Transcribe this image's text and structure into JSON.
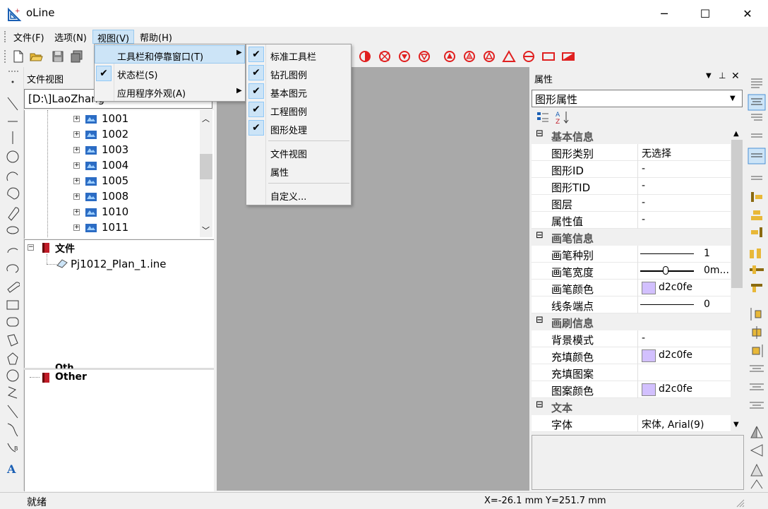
{
  "window": {
    "title": "oLine",
    "minimize": "─",
    "maximize": "☐",
    "close": "✕"
  },
  "menubar": [
    "文件(F)",
    "选项(N)",
    "视图(V)",
    "帮助(H)"
  ],
  "file_view": {
    "title": "文件视图",
    "path": "[D:\\]LaoZhang",
    "nodes": [
      "1001",
      "1002",
      "1003",
      "1004",
      "1005",
      "1008",
      "1010",
      "1011"
    ],
    "section_file": "文件",
    "file_item": "Pj1012_Plan_1.ine",
    "section_other": "Other",
    "other_partial": "Oth"
  },
  "view_menu": {
    "items": [
      "工具栏和停靠窗口(T)",
      "状态栏(S)",
      "应用程序外观(A)"
    ],
    "checked": [
      false,
      true,
      false
    ]
  },
  "toolbar_submenu": {
    "checked_items": [
      "标准工具栏",
      "钻孔图例",
      "基本图元",
      "工程图例",
      "图形处理"
    ],
    "items": [
      "文件视图",
      "属性",
      "自定义..."
    ]
  },
  "properties": {
    "title": "属性",
    "selector": "图形属性",
    "categories": {
      "basic": "基本信息",
      "pen": "画笔信息",
      "brush": "画刷信息",
      "text": "文本"
    },
    "basic_rows": [
      {
        "name": "图形类别",
        "value": "无选择"
      },
      {
        "name": "图形ID",
        "value": "-"
      },
      {
        "name": "图形TID",
        "value": "-"
      },
      {
        "name": "图层",
        "value": "-"
      },
      {
        "name": "属性值",
        "value": "-"
      }
    ],
    "pen_rows": [
      {
        "name": "画笔种别",
        "value": "1"
      },
      {
        "name": "画笔宽度",
        "value": "0m..."
      },
      {
        "name": "画笔颜色",
        "value": "d2c0fe"
      },
      {
        "name": "线条端点",
        "value": "0"
      }
    ],
    "brush_rows": [
      {
        "name": "背景模式",
        "value": "-"
      },
      {
        "name": "充填颜色",
        "value": "d2c0fe"
      },
      {
        "name": "充填图案",
        "value": ""
      },
      {
        "name": "图案颜色",
        "value": "d2c0fe"
      }
    ],
    "text_rows": [
      {
        "name": "字体",
        "value": "宋体, Arial(9)"
      }
    ]
  },
  "status": {
    "left": "就绪",
    "coords": "X=-26.1 mm  Y=251.7 mm"
  },
  "colors": {
    "swatch": "#d2c0fe",
    "toolbar_red": "#e02020",
    "menu_highlight": "#cce4f7"
  }
}
